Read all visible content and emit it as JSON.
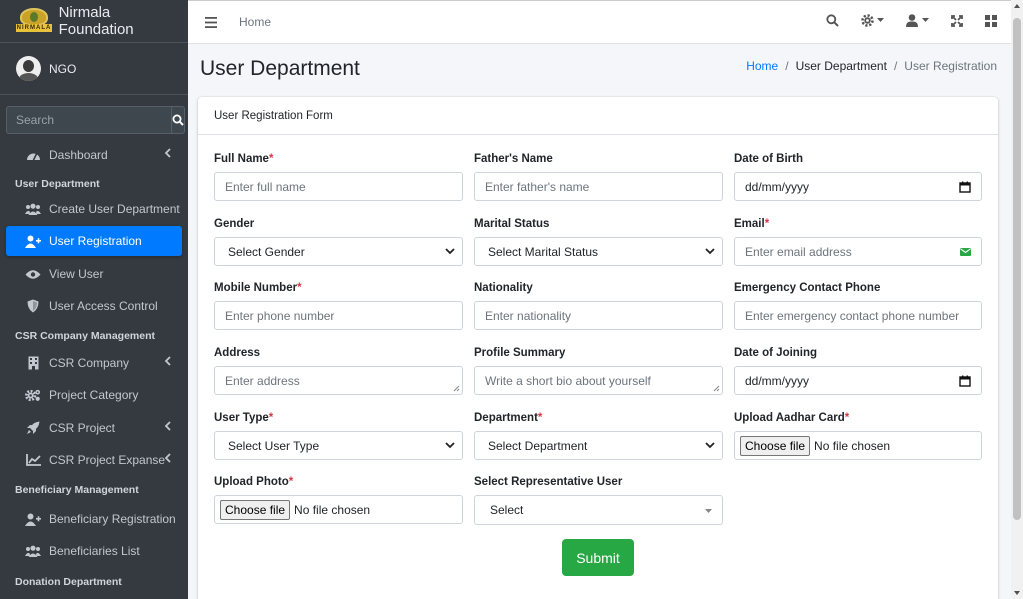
{
  "brand": {
    "name": "Nirmala Foundation",
    "logo_text": "NIRMALA"
  },
  "user": {
    "name": "NGO"
  },
  "sidebar": {
    "search_placeholder": "Search",
    "items": [
      {
        "label": "Dashboard",
        "icon": "dashboard-icon",
        "has_chevron": true
      },
      {
        "header": "User Department"
      },
      {
        "label": "Create User Department",
        "icon": "users-icon"
      },
      {
        "label": "User Registration",
        "icon": "user-plus-icon",
        "active": true
      },
      {
        "label": "View User",
        "icon": "eye-icon"
      },
      {
        "label": "User Access Control",
        "icon": "shield-icon"
      },
      {
        "header": "CSR Company Management"
      },
      {
        "label": "CSR Company",
        "icon": "building-icon",
        "has_chevron": true
      },
      {
        "label": "Project Category",
        "icon": "cogs-icon"
      },
      {
        "label": "CSR Project",
        "icon": "rocket-icon",
        "has_chevron": true
      },
      {
        "label": "CSR Project Expanse",
        "icon": "chart-icon",
        "has_chevron": true
      },
      {
        "header": "Beneficiary Management"
      },
      {
        "label": "Beneficiary Registration",
        "icon": "user-plus-icon"
      },
      {
        "label": "Beneficiaries List",
        "icon": "users-icon"
      },
      {
        "header": "Donation Department"
      }
    ]
  },
  "topbar": {
    "home_link": "Home"
  },
  "page": {
    "title": "User Department"
  },
  "breadcrumb": {
    "home": "Home",
    "middle": "User Department",
    "current": "User Registration"
  },
  "form": {
    "title": "User Registration Form",
    "full_name": {
      "label": "Full Name",
      "placeholder": "Enter full name"
    },
    "father_name": {
      "label": "Father's Name",
      "placeholder": "Enter father's name"
    },
    "dob": {
      "label": "Date of Birth",
      "value": "dd/mm/yyyy"
    },
    "gender": {
      "label": "Gender",
      "value": "Select Gender"
    },
    "marital_status": {
      "label": "Marital Status",
      "value": "Select Marital Status"
    },
    "email": {
      "label": "Email",
      "placeholder": "Enter email address"
    },
    "mobile": {
      "label": "Mobile Number",
      "placeholder": "Enter phone number"
    },
    "nationality": {
      "label": "Nationality",
      "placeholder": "Enter nationality"
    },
    "emergency_phone": {
      "label": "Emergency Contact Phone",
      "placeholder": "Enter emergency contact phone number"
    },
    "address": {
      "label": "Address",
      "placeholder": "Enter address"
    },
    "profile_summary": {
      "label": "Profile Summary",
      "placeholder": "Write a short bio about yourself"
    },
    "doj": {
      "label": "Date of Joining",
      "value": "dd/mm/yyyy"
    },
    "user_type": {
      "label": "User Type",
      "value": "Select User Type"
    },
    "department": {
      "label": "Department",
      "value": "Select Department"
    },
    "aadhar": {
      "label": "Upload Aadhar Card",
      "button": "Choose file",
      "status": "No file chosen"
    },
    "photo": {
      "label": "Upload Photo",
      "button": "Choose file",
      "status": "No file chosen"
    },
    "representative": {
      "label": "Select Representative User",
      "value": "Select"
    },
    "required_mark": "*",
    "submit": "Submit"
  }
}
